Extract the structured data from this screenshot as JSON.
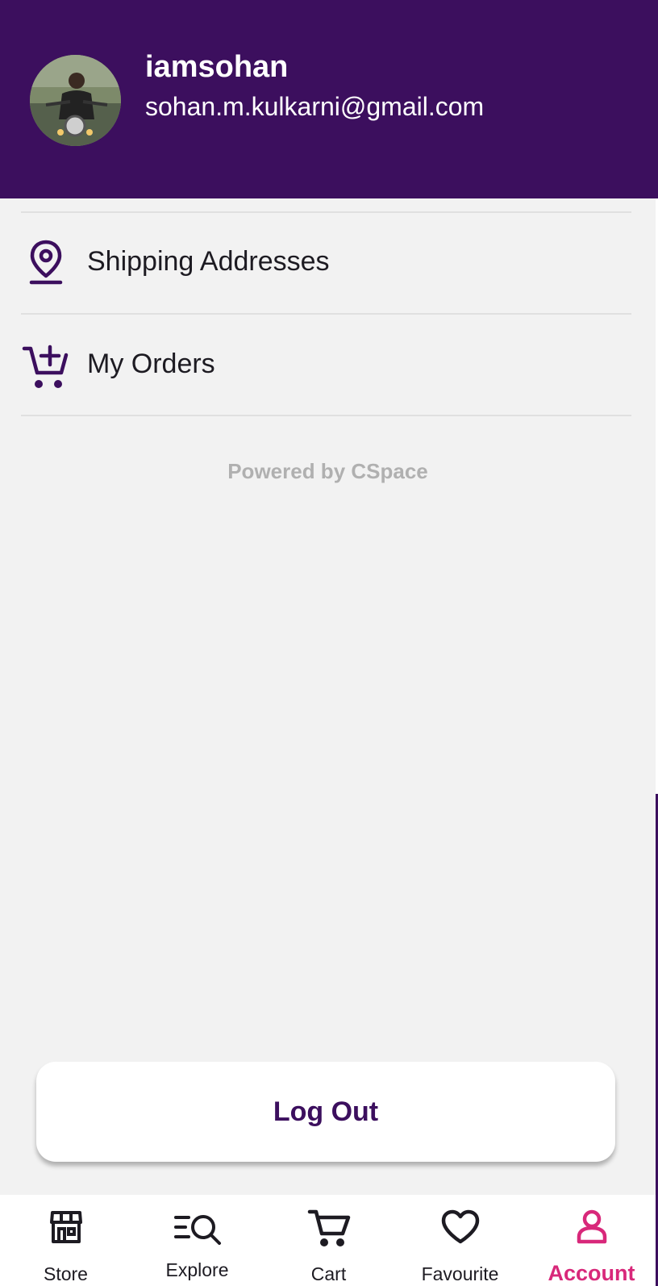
{
  "header": {
    "username": "iamsohan",
    "email": "sohan.m.kulkarni@gmail.com"
  },
  "menu": {
    "items": [
      {
        "label": "Shipping Addresses",
        "icon": "location-pin-icon"
      },
      {
        "label": "My Orders",
        "icon": "add-to-cart-icon"
      }
    ]
  },
  "footer_note": "Powered by CSpace",
  "logout": {
    "label": "Log Out"
  },
  "bottom_nav": {
    "items": [
      {
        "label": "Store",
        "icon": "store-icon"
      },
      {
        "label": "Explore",
        "icon": "explore-search-icon"
      },
      {
        "label": "Cart",
        "icon": "cart-icon"
      },
      {
        "label": "Favourite",
        "icon": "heart-icon"
      },
      {
        "label": "Account",
        "icon": "account-icon",
        "active": true
      }
    ]
  },
  "colors": {
    "primary": "#3c0f5e",
    "accent": "#d8287a",
    "background": "#f2f2f2",
    "muted_text": "#b0b0b0"
  }
}
